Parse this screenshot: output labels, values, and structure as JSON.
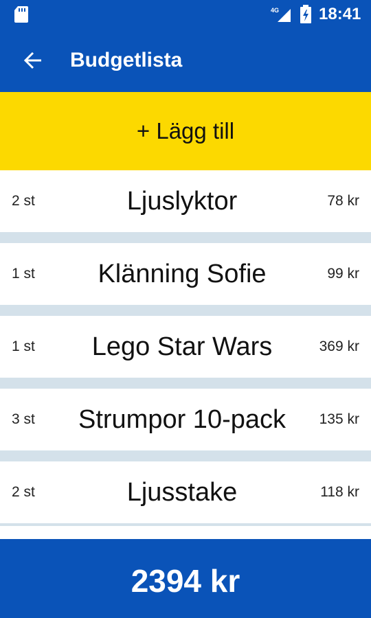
{
  "status_bar": {
    "time": "18:41",
    "network": "4G",
    "icons": [
      "sd-card-icon",
      "signal-icon",
      "battery-icon"
    ]
  },
  "app_bar": {
    "title": "Budgetlista",
    "back_icon": "arrow-left-icon"
  },
  "add_button": {
    "label": "+ Lägg till"
  },
  "items": [
    {
      "qty": "2 st",
      "name": "Ljuslyktor",
      "price": "78 kr"
    },
    {
      "qty": "1 st",
      "name": "Klänning Sofie",
      "price": "99 kr"
    },
    {
      "qty": "1 st",
      "name": "Lego Star Wars",
      "price": "369 kr"
    },
    {
      "qty": "3 st",
      "name": "Strumpor 10-pack",
      "price": "135 kr"
    },
    {
      "qty": "2 st",
      "name": "Ljusstake",
      "price": "118 kr"
    }
  ],
  "total": {
    "label": "2394 kr"
  },
  "colors": {
    "primary": "#0a53b8",
    "accent": "#fcd900",
    "separator": "#d4e1ea",
    "item_bg": "#ffffff"
  }
}
